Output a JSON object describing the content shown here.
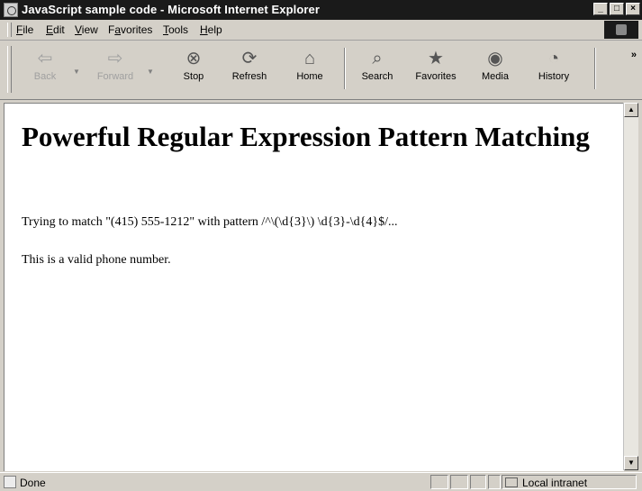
{
  "window": {
    "title": "JavaScript sample code - Microsoft Internet Explorer",
    "controls": {
      "minimize": "_",
      "maximize": "□",
      "close": "×"
    }
  },
  "menu": {
    "items": [
      {
        "underline": "F",
        "rest": "ile"
      },
      {
        "underline": "E",
        "rest": "dit"
      },
      {
        "underline": "V",
        "rest": "iew"
      },
      {
        "pre": "F",
        "underline": "a",
        "rest": "vorites"
      },
      {
        "underline": "T",
        "rest": "ools"
      },
      {
        "underline": "H",
        "rest": "elp"
      }
    ]
  },
  "toolbar": {
    "buttons": [
      {
        "label": "Back",
        "icon": "back-arrow-icon",
        "glyph": "⇦",
        "enabled": false
      },
      {
        "label": "Forward",
        "icon": "forward-arrow-icon",
        "glyph": "⇨",
        "enabled": false
      },
      {
        "label": "Stop",
        "icon": "stop-icon",
        "glyph": "⊗",
        "enabled": true
      },
      {
        "label": "Refresh",
        "icon": "refresh-icon",
        "glyph": "⟳",
        "enabled": true
      },
      {
        "label": "Home",
        "icon": "home-icon",
        "glyph": "⌂",
        "enabled": true
      },
      {
        "label": "Search",
        "icon": "search-icon",
        "glyph": "⌕",
        "enabled": true
      },
      {
        "label": "Favorites",
        "icon": "favorites-icon",
        "glyph": "★",
        "enabled": true
      },
      {
        "label": "Media",
        "icon": "media-icon",
        "glyph": "◉",
        "enabled": true
      },
      {
        "label": "History",
        "icon": "history-icon",
        "glyph": "◔",
        "enabled": true
      }
    ],
    "overflow": "»"
  },
  "page": {
    "heading": "Powerful Regular Expression Pattern Matching",
    "paragraph1": "Trying to match \"(415) 555-1212\" with pattern /^\\(\\d{3}\\) \\d{3}-\\d{4}$/...",
    "paragraph2": "This is a valid phone number."
  },
  "status": {
    "text": "Done",
    "zone": "Local intranet"
  }
}
